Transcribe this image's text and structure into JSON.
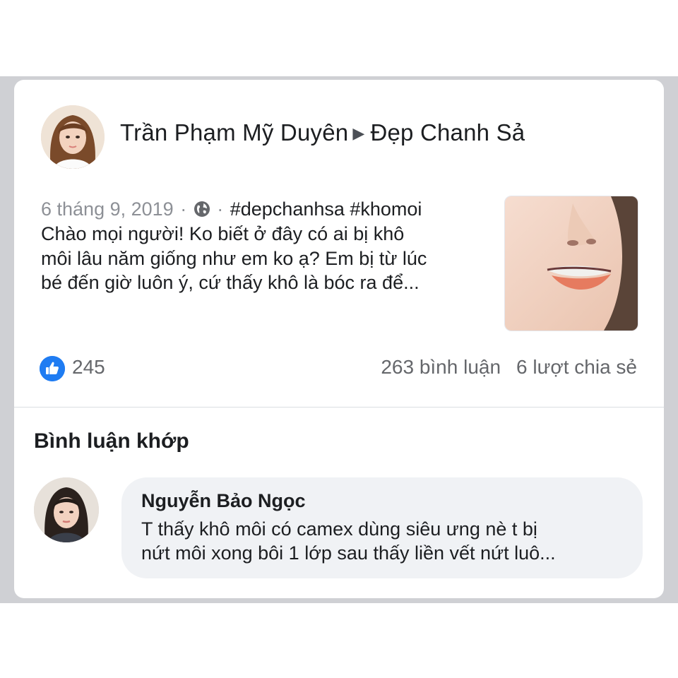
{
  "post": {
    "author": "Trần Phạm Mỹ Duyên",
    "arrow": "▶",
    "group": "Đẹp Chanh Sả",
    "date": "6 tháng 9, 2019",
    "separator": "·",
    "privacy_icon": "globe-icon",
    "hashtags": "#depchanhsa #khomoi",
    "text_lines": [
      "Chào mọi người! Ko biết ở đây có ai bị khô",
      "môi lâu năm giống như em ko ạ? Em bị từ lúc",
      "bé đến giờ luôn ý, cứ thấy khô là bóc ra để..."
    ]
  },
  "stats": {
    "like_icon": "thumbs-up-icon",
    "likes": "245",
    "comments": "263 bình luận",
    "shares": "6 lượt chia sẻ"
  },
  "comments_section": {
    "title": "Bình luận khớp",
    "comment": {
      "name": "Nguyễn Bảo Ngọc",
      "text_lines": [
        "T thấy khô môi có camex dùng siêu ưng nè t bị",
        "nứt môi xong bôi 1 lớp sau thấy liền vết nứt luô..."
      ]
    }
  },
  "colors": {
    "like_blue": "#1f7cf2",
    "text": "#1c1e21",
    "muted": "#65676b",
    "bubble": "#f0f2f5"
  }
}
